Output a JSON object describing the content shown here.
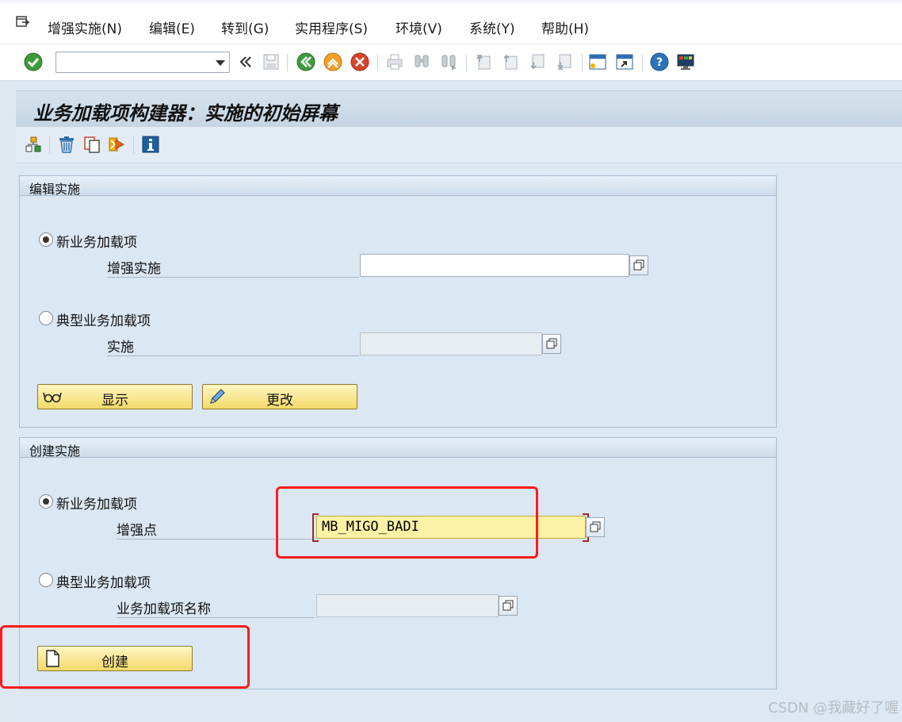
{
  "menubar": {
    "items": [
      {
        "label": "增强实施(N)"
      },
      {
        "label": "编辑(E)"
      },
      {
        "label": "转到(G)"
      },
      {
        "label": "实用程序(S)"
      },
      {
        "label": "环境(V)"
      },
      {
        "label": "系统(Y)"
      },
      {
        "label": "帮助(H)"
      }
    ]
  },
  "toolbar": {
    "command_field_value": "",
    "icons": [
      "enter-icon",
      "command-dropdown-icon",
      "collapse-icon",
      "save-icon",
      "back-icon",
      "exit-icon",
      "cancel-icon",
      "print-icon",
      "find-icon",
      "find-next-icon",
      "first-page-icon",
      "previous-page-icon",
      "next-page-icon",
      "last-page-icon",
      "new-session-icon",
      "shortcut-icon",
      "help-icon",
      "customize-layout-icon"
    ]
  },
  "page": {
    "title": "业务加载项构建器：实施的初始屏幕"
  },
  "app_toolbar": {
    "icons": [
      "hierarchy-icon",
      "delete-icon",
      "copy-icon",
      "rename-icon",
      "info-icon"
    ]
  },
  "edit_group": {
    "title": "编辑实施",
    "new_badi_radio_label": "新业务加载项",
    "enhancement_impl_label": "增强实施",
    "enhancement_impl_value": "",
    "classic_badi_radio_label": "典型业务加载项",
    "implementation_label": "实施",
    "implementation_value": "",
    "display_button_label": "显示",
    "change_button_label": "更改",
    "selected_radio": "new_badi"
  },
  "create_group": {
    "title": "创建实施",
    "new_badi_radio_label": "新业务加载项",
    "enhancement_spot_label": "增强点",
    "enhancement_spot_value": "MB_MIGO_BADI",
    "classic_badi_radio_label": "典型业务加载项",
    "badi_name_label": "业务加载项名称",
    "badi_name_value": "",
    "create_button_label": "创建",
    "selected_radio": "new_badi"
  },
  "colors": {
    "highlight_box": "#ff1b1b",
    "required_field": "#fdf1a6",
    "button_fill": "#f3da68",
    "title_bar": "#c4d5e4"
  },
  "watermark": "CSDN @我藏好了喔"
}
